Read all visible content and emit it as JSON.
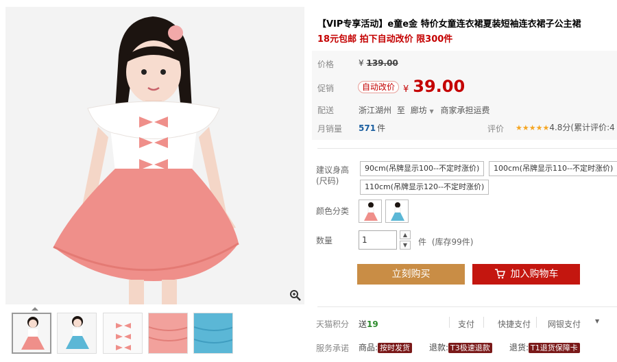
{
  "product": {
    "title": "【VIP专享活动】e童e金 特价女童连衣裙夏装短袖连衣裙子公主裙",
    "subtitle": "18元包邮 拍下自动改价 限300件"
  },
  "price": {
    "label": "价格",
    "currency": "¥",
    "original": "139.00"
  },
  "promo": {
    "label": "促销",
    "badge": "自动改价",
    "currency": "¥",
    "value": "39.00"
  },
  "shipping": {
    "label": "配送",
    "from": "浙江湖州",
    "to_word": "至",
    "dest": "廊坊",
    "note": "商家承担运费"
  },
  "sales": {
    "label": "月销量",
    "count": "571",
    "unit": "件"
  },
  "rating": {
    "label": "评价",
    "stars": "★★★★★",
    "score": "4.8分",
    "count_text": "(累计评价:4"
  },
  "size": {
    "label": "建议身高(尺码)",
    "options": [
      "90cm(吊牌显示100--不定时涨价)",
      "100cm(吊牌显示110--不定时涨价)",
      "110cm(吊牌显示120--不定时涨价)"
    ]
  },
  "color": {
    "label": "颜色分类"
  },
  "quantity": {
    "label": "数量",
    "value": "1",
    "unit": "件",
    "stock": "(库存99件)"
  },
  "actions": {
    "buy": "立刻购买",
    "cart": "加入购物车"
  },
  "points": {
    "label": "天猫积分",
    "send": "送",
    "amount": "19",
    "pay_links": [
      "支付",
      "快捷支付",
      "网银支付"
    ]
  },
  "service": {
    "label": "服务承诺",
    "items": [
      {
        "prefix": "商品:",
        "tag": "按时发货"
      },
      {
        "prefix": "退款:",
        "tag": "T3极速退款"
      },
      {
        "prefix": "退货:",
        "tag": "T1退货保障卡"
      }
    ]
  },
  "colors": {
    "price_red": "#c40000",
    "buy_orange": "#c98d45",
    "cart_red": "#c4160f",
    "dress_pink": "#ef8f8a",
    "dress_blue": "#5bb7d6",
    "star_orange": "#f5a623"
  }
}
